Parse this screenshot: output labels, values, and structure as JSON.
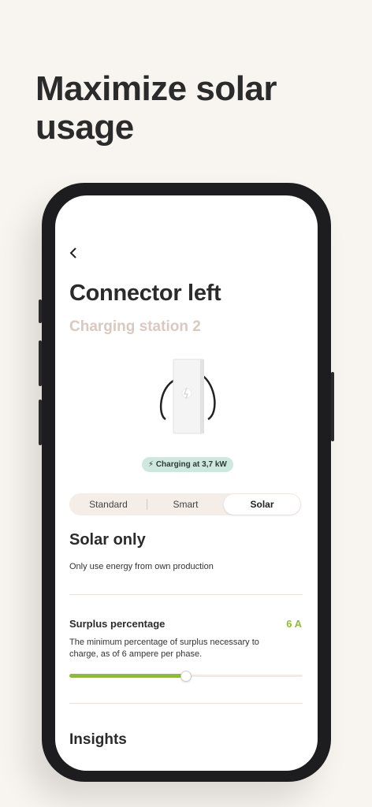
{
  "headline": "Maximize solar usage",
  "screen": {
    "back_icon": "chevron-left-icon",
    "title": "Connector left",
    "subtitle": "Charging station 2",
    "status_badge": "Charging at 3,7 kW",
    "tabs": [
      {
        "label": "Standard",
        "active": false
      },
      {
        "label": "Smart",
        "active": false
      },
      {
        "label": "Solar",
        "active": true
      }
    ],
    "mode": {
      "title": "Solar only",
      "description": "Only use energy from own production"
    },
    "surplus": {
      "title": "Surplus percentage",
      "value": "6 A",
      "description": "The minimum percentage of surplus necessary to charge, as of 6 ampere per phase.",
      "slider_fraction": 0.5
    },
    "insights_title": "Insights"
  },
  "colors": {
    "accent": "#8cbf2a",
    "badge_bg": "#cfe8df",
    "subtitle": "#d9c9c0",
    "background": "#f8f4ef"
  }
}
